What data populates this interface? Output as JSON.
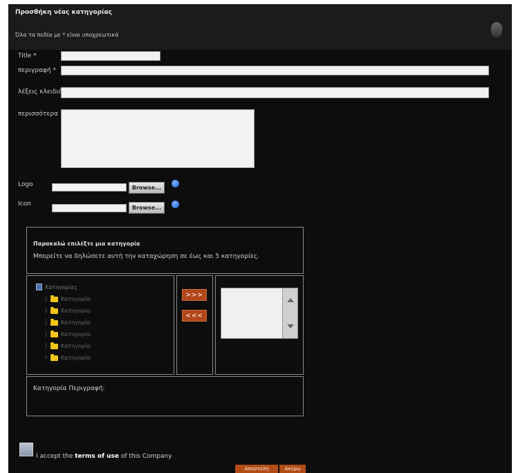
{
  "dialog": {
    "title": "Προσθήκη νέας κατηγορίας",
    "subtitle": "Όλα τα πεδία με * είναι υποχρεωτικά"
  },
  "form": {
    "title_label": "Title *",
    "title_value": "",
    "description_label": "περιγραφή *",
    "description_value": "",
    "keywords_label": "λέξεις κλειδιά",
    "keywords_value": "",
    "more_label": "περισσότερα",
    "more_value": "",
    "logo_label": "Logo",
    "icon_label": "Icon",
    "browse_label": "Browse..."
  },
  "category_box": {
    "title": "Παρακαλώ επιλέξτε μια κατηγορία",
    "text": "Μπορείτε να δηλώσετε αυτή την καταχώρηση σε έως και 5 κατηγορίες."
  },
  "tree": {
    "root_label": "Κατηγορίες",
    "items": [
      "Κατηγορία",
      "Κατηγορία",
      "Κατηγορία",
      "Κατηγορία",
      "Κατηγορία",
      "Κατηγορία"
    ]
  },
  "buttons": {
    "add_label": ">>>",
    "remove_label": "<<<",
    "submit_label": "Αποστολή",
    "cancel_label": "Ακύρω"
  },
  "description_box": {
    "label": "Κατηγορία Περιγραφή:"
  },
  "terms": {
    "prefix": "I accept the ",
    "link": "terms of use",
    "suffix": " of this Company"
  },
  "colors": {
    "background": "#0d0d0d",
    "header": "#1b1b1b",
    "accent": "#b0461a"
  }
}
